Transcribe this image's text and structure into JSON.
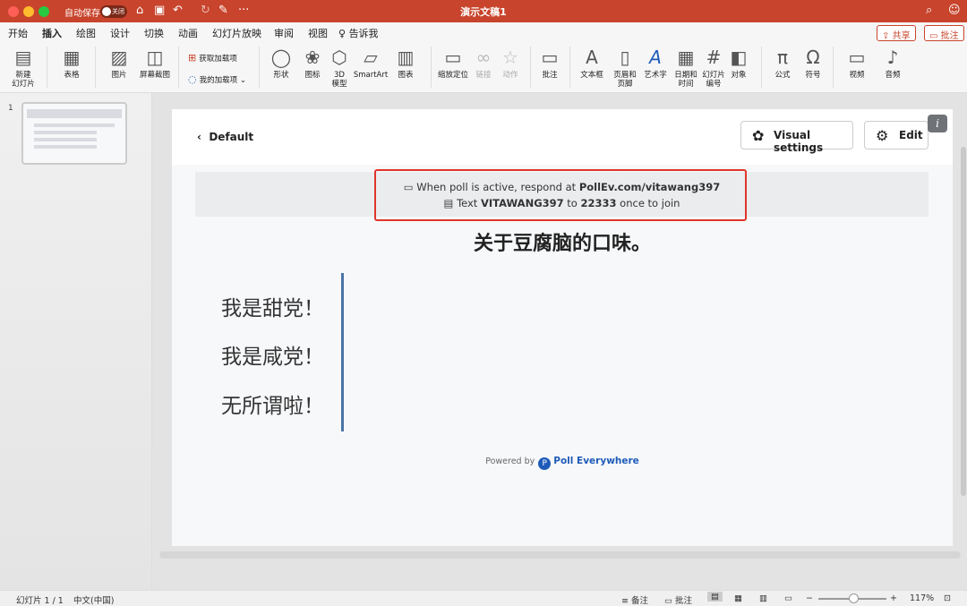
{
  "titlebar": {
    "autosave_label": "自动保存",
    "toggle_label": "关闭",
    "doc_title": "演示文稿1",
    "more_glyph": "···"
  },
  "tabs": [
    "开始",
    "插入",
    "绘图",
    "设计",
    "切换",
    "动画",
    "幻灯片放映",
    "审阅",
    "视图",
    "告诉我"
  ],
  "active_tab": "插入",
  "share_label": "共享",
  "comment_label": "批注",
  "ribbon": {
    "new_slide": "新建\n幻灯片",
    "table": "表格",
    "picture": "图片",
    "screenshot": "屏幕截图",
    "get_addins": "获取加载项",
    "my_addins": "我的加载项",
    "shapes": "形状",
    "icons": "图标",
    "model3d": "3D\n模型",
    "smartart": "SmartArt",
    "chart": "图表",
    "zoom": "缩放定位",
    "link": "链接",
    "action": "动作",
    "comment": "批注",
    "textbox": "文本框",
    "header_footer": "页眉和\n页脚",
    "wordart": "艺术字",
    "datetime": "日期和\n时间",
    "slide_number": "幻灯片\n编号",
    "object": "对象",
    "equation": "公式",
    "symbol": "符号",
    "video": "视频",
    "audio": "音频"
  },
  "thumbnail": {
    "number": "1"
  },
  "slide": {
    "back_label": "Default",
    "visual_settings_label": "Visual settings",
    "edit_label": "Edit",
    "info_label": "i",
    "respond_prefix": "When poll is active, respond at ",
    "respond_url": "PollEv.com/vitawang397",
    "text_prefix": "Text ",
    "text_code": "VITAWANG397",
    "text_to": " to ",
    "text_number": "22333",
    "text_suffix": " once to join",
    "question": "关于豆腐脑的口味。",
    "options": [
      "我是甜党！",
      "我是咸党！",
      "无所谓啦！"
    ],
    "powered_by": "Powered by",
    "brand": "Poll Everywhere"
  },
  "status": {
    "slide_count": "幻灯片 1 / 1",
    "language": "中文(中国)",
    "notes": "备注",
    "comments": "批注",
    "zoom": "117%"
  },
  "colors": {
    "accent": "#c8442c",
    "highlight": "#e0352b",
    "poll_blue": "#1e5bb8"
  }
}
